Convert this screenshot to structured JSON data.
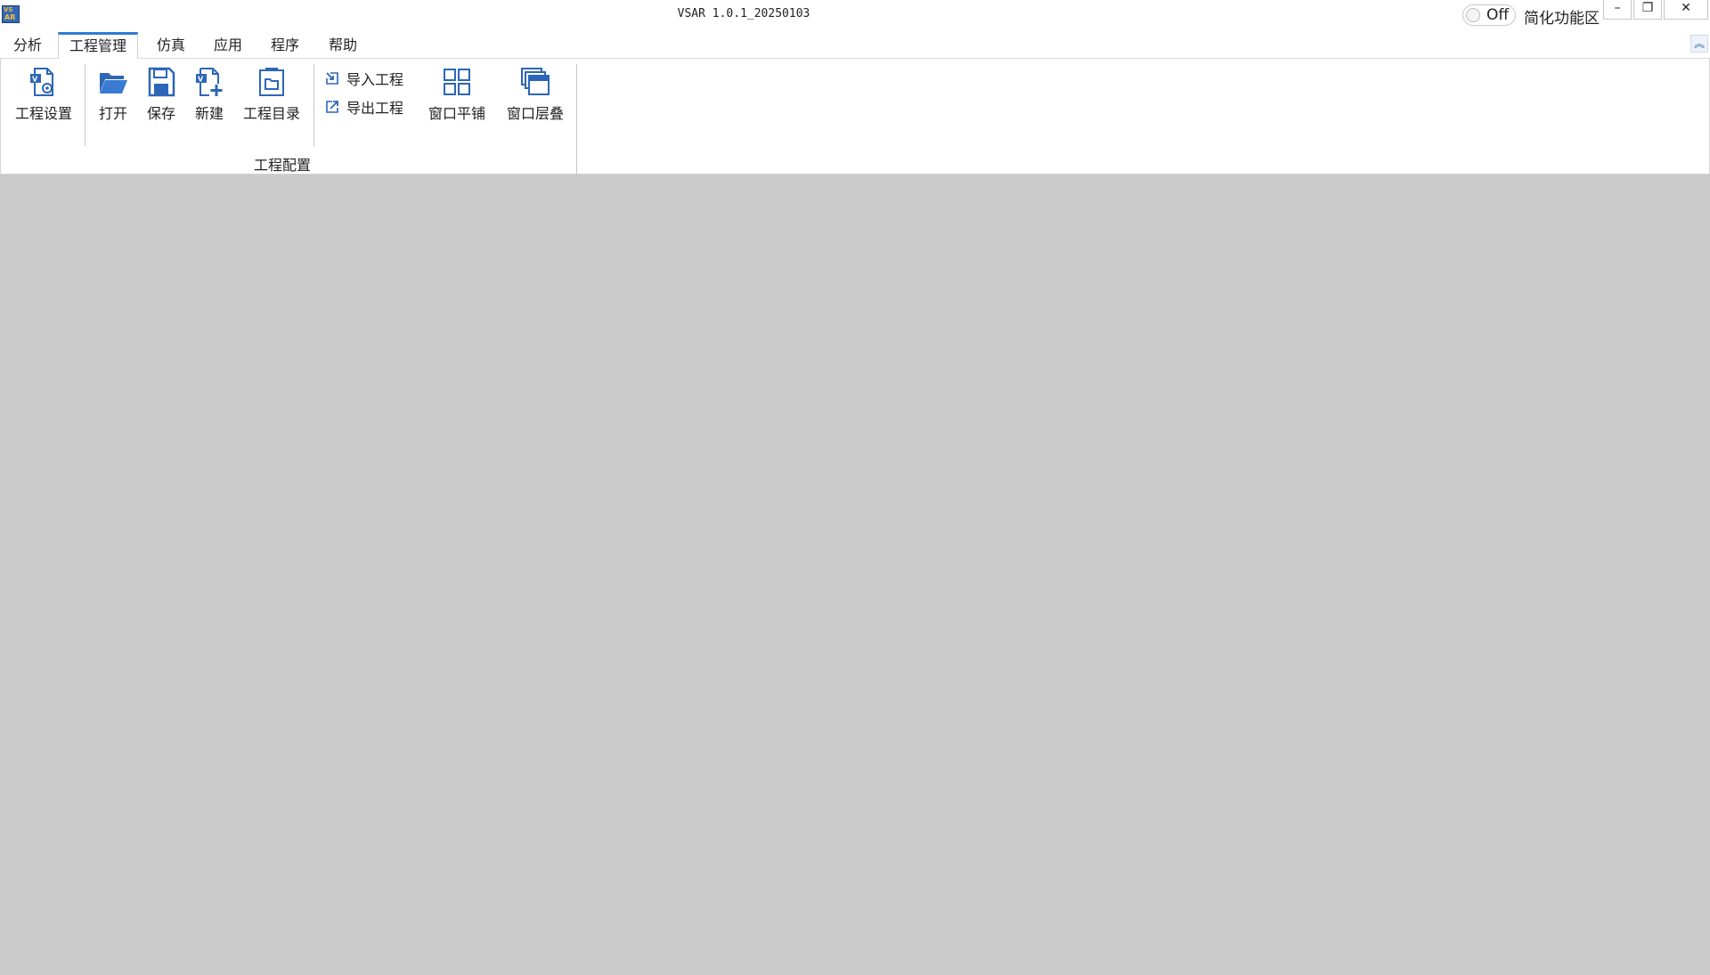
{
  "window": {
    "title": "VSAR 1.0.1_20250103",
    "toggle_state": "Off",
    "simplify_label": "简化功能区",
    "minimize": "–",
    "restore": "❐",
    "close": "✕"
  },
  "menu": {
    "tabs": [
      {
        "label": "分析"
      },
      {
        "label": "工程管理",
        "active": true
      },
      {
        "label": "仿真"
      },
      {
        "label": "应用"
      },
      {
        "label": "程序"
      },
      {
        "label": "帮助"
      }
    ],
    "collapse": "︽"
  },
  "ribbon": {
    "project_settings": "工程设置",
    "open": "打开",
    "save": "保存",
    "new": "新建",
    "project_dir": "工程目录",
    "import_project": "导入工程",
    "export_project": "导出工程",
    "window_tile": "窗口平铺",
    "window_cascade": "窗口层叠",
    "group_label": "工程配置"
  },
  "colors": {
    "accent": "#2f7bd3",
    "icon_blue": "#2d66b8",
    "workspace": "#cbcbcb"
  }
}
